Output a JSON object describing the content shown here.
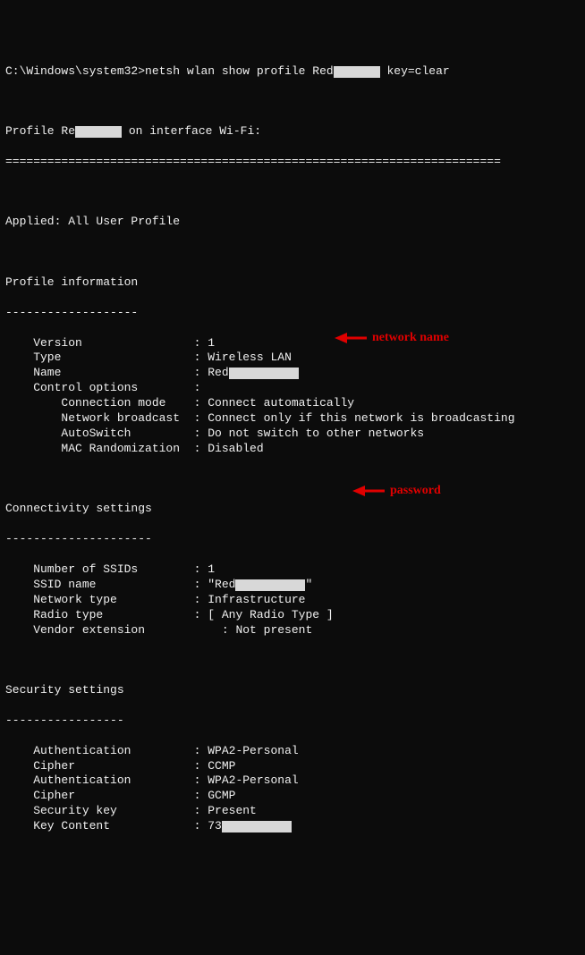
{
  "prompt": {
    "path": "C:\\Windows\\system32>",
    "cmd_prefix": "netsh wlan show profile Red",
    "cmd_suffix": " key=clear"
  },
  "header": {
    "profile_prefix": "Profile Re",
    "profile_suffix": " on interface Wi-Fi:",
    "separator": "======================================================================="
  },
  "applied": "Applied: All User Profile",
  "profile_info": {
    "title": "Profile information",
    "dash": "-------------------",
    "rows": [
      {
        "label": "    Version",
        "value": "1"
      },
      {
        "label": "    Type",
        "value": "Wireless LAN"
      },
      {
        "label": "    Name",
        "value": "Red",
        "redact_after": true
      },
      {
        "label": "    Control options",
        "value": ""
      },
      {
        "label": "        Connection mode",
        "value": "Connect automatically"
      },
      {
        "label": "        Network broadcast",
        "value": "Connect only if this network is broadcasting"
      },
      {
        "label": "        AutoSwitch",
        "value": "Do not switch to other networks"
      },
      {
        "label": "        MAC Randomization",
        "value": "Disabled"
      }
    ]
  },
  "connectivity": {
    "title": "Connectivity settings",
    "dash": "---------------------",
    "rows": [
      {
        "label": "    Number of SSIDs",
        "value": "1"
      },
      {
        "label": "    SSID name",
        "value": "\"Red",
        "redact_after": true,
        "redact_suffix": "\""
      },
      {
        "label": "    Network type",
        "value": "Infrastructure"
      },
      {
        "label": "    Radio type",
        "value": "[ Any Radio Type ]"
      },
      {
        "label": "    Vendor extension",
        "value": "    : Not present",
        "no_colon": true
      }
    ]
  },
  "security": {
    "title": "Security settings",
    "dash": "-----------------",
    "rows": [
      {
        "label": "    Authentication",
        "value": "WPA2-Personal"
      },
      {
        "label": "    Cipher",
        "value": "CCMP"
      },
      {
        "label": "    Authentication",
        "value": "WPA2-Personal"
      },
      {
        "label": "    Cipher",
        "value": "GCMP"
      },
      {
        "label": "    Security key",
        "value": "Present"
      },
      {
        "label": "    Key Content",
        "value": "73",
        "redact_after": true
      }
    ]
  },
  "annotations": {
    "network_name": "network name",
    "password": "password"
  }
}
